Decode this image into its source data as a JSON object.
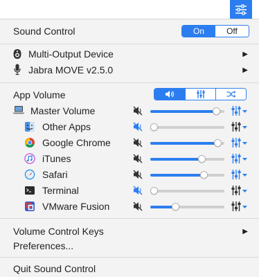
{
  "menu": {
    "sound_control_label": "Sound Control",
    "on_label": "On",
    "off_label": "Off",
    "devices": [
      {
        "label": "Multi-Output Device",
        "icon": "speaker-icon"
      },
      {
        "label": "Jabra MOVE v2.5.0",
        "icon": "microphone-icon"
      }
    ],
    "app_volume_label": "App Volume",
    "app_volume_tabs": [
      "volume-tab",
      "equalizer-tab",
      "shuffle-tab"
    ],
    "apps": [
      {
        "label": "Master Volume",
        "icon": "laptop-icon",
        "muted": true,
        "mute_blue": false,
        "volume": 0.94,
        "eq_blue": true
      },
      {
        "label": "Other Apps",
        "icon": "finder-icon",
        "muted": true,
        "mute_blue": true,
        "volume": 0.0,
        "eq_blue": false
      },
      {
        "label": "Google Chrome",
        "icon": "chrome-icon",
        "muted": true,
        "mute_blue": false,
        "volume": 0.96,
        "eq_blue": true
      },
      {
        "label": "iTunes",
        "icon": "itunes-icon",
        "muted": true,
        "mute_blue": false,
        "volume": 0.72,
        "eq_blue": true
      },
      {
        "label": "Safari",
        "icon": "safari-icon",
        "muted": true,
        "mute_blue": false,
        "volume": 0.75,
        "eq_blue": true
      },
      {
        "label": "Terminal",
        "icon": "terminal-icon",
        "muted": true,
        "mute_blue": true,
        "volume": 0.0,
        "eq_blue": false
      },
      {
        "label": "VMware Fusion",
        "icon": "vmware-icon",
        "muted": true,
        "mute_blue": false,
        "volume": 0.32,
        "eq_blue": false
      }
    ],
    "volume_keys_label": "Volume Control Keys",
    "preferences_label": "Preferences...",
    "quit_label": "Quit Sound Control"
  },
  "colors": {
    "accent": "#2c7ef0",
    "menu_bg": "#f3f3f3"
  }
}
